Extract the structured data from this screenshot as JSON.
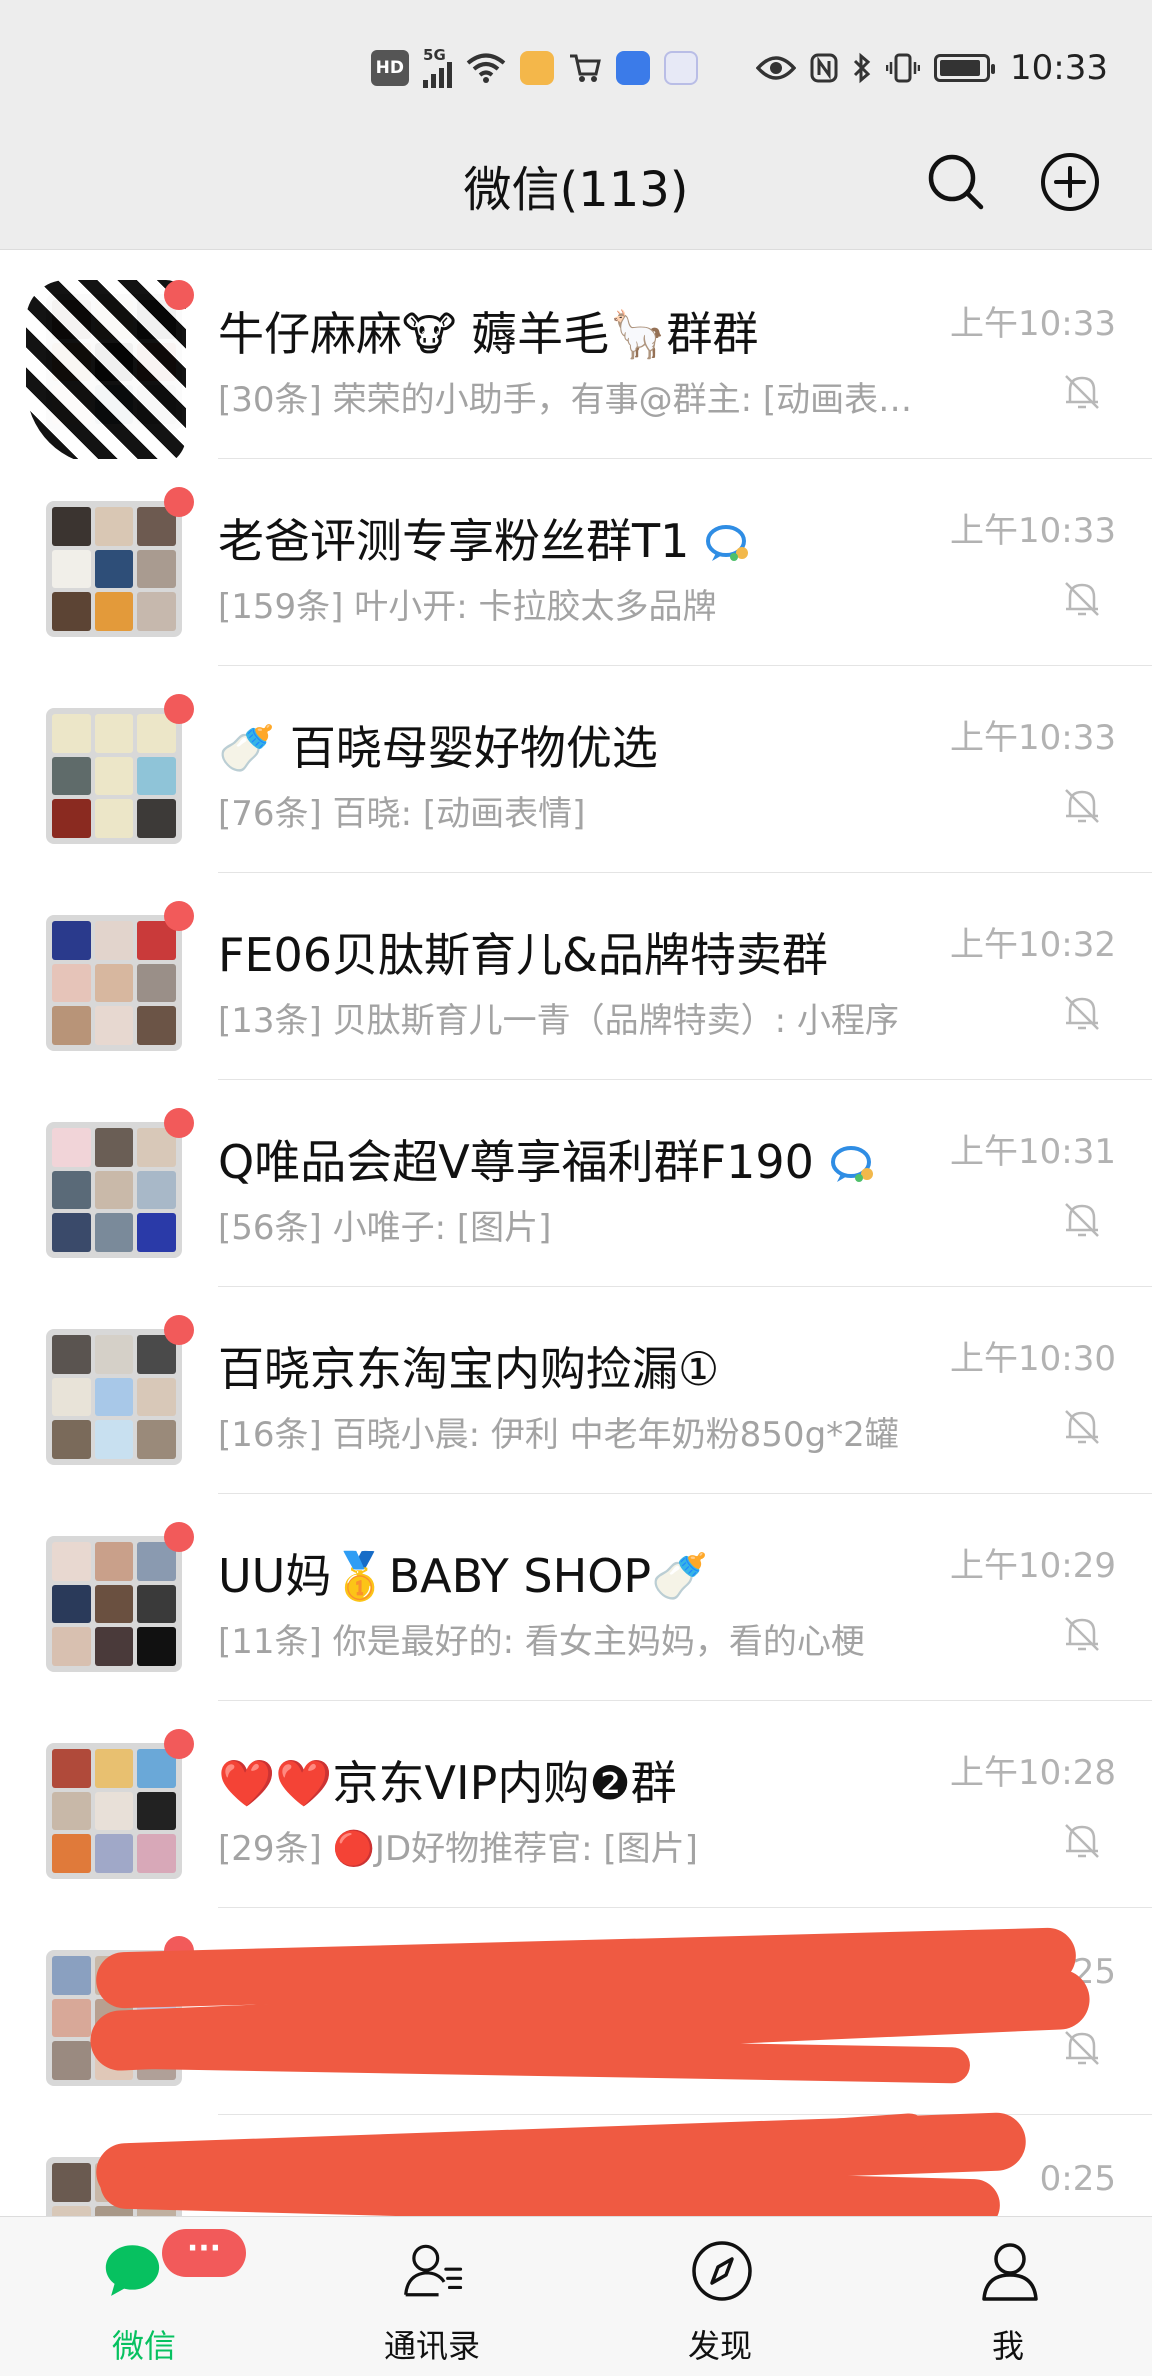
{
  "status_bar": {
    "hd": "HD",
    "network": "5G",
    "time": "10:33"
  },
  "header": {
    "title": "微信(113)",
    "icons": [
      "search-icon",
      "add-icon"
    ]
  },
  "chats": [
    {
      "name": "牛仔麻麻🐮 薅羊毛🦙群群",
      "preview": "[30条] 荣荣的小助手，有事@群主: [动画表情]",
      "time": "上午10:33",
      "muted": true
    },
    {
      "name": "老爸评测专享粉丝群T1",
      "preview": "[159条] 叶小开: 卡拉胶太多品牌",
      "time": "上午10:33",
      "muted": true
    },
    {
      "name": "🍼 百晓母婴好物优选",
      "preview": "[76条] 百晓: [动画表情]",
      "time": "上午10:33",
      "muted": true
    },
    {
      "name": "FE06贝肽斯育儿&品牌特卖群",
      "preview": "[13条] 贝肽斯育儿一青（品牌特卖）: 小程序",
      "time": "上午10:32",
      "muted": true
    },
    {
      "name": "Q唯品会超V尊享福利群F190",
      "preview": "[56条] 小唯子: [图片]",
      "time": "上午10:31",
      "muted": true
    },
    {
      "name": "百晓京东淘宝内购捡漏①",
      "preview": "[16条] 百晓小晨: 伊利 中老年奶粉850g*2罐",
      "time": "上午10:30",
      "muted": true
    },
    {
      "name": "UU妈🥇BABY SHOP🍼",
      "preview": "[11条] 你是最好的: 看女主妈妈，看的心梗",
      "time": "上午10:29",
      "muted": true
    },
    {
      "name": "❤️❤️京东VIP内购❷群",
      "preview": "[29条] 🔴JD好物推荐官: [图片]",
      "time": "上午10:28",
      "muted": true
    },
    {
      "name": "",
      "preview": "",
      "time": "25",
      "muted": true
    },
    {
      "name": "",
      "preview": "",
      "time": "0:25",
      "muted": false
    }
  ],
  "tabbar": {
    "badge": "···",
    "tabs": [
      {
        "label": "微信",
        "icon": "chat-icon",
        "active": true
      },
      {
        "label": "通讯录",
        "icon": "contacts-icon",
        "active": false
      },
      {
        "label": "发现",
        "icon": "compass-icon",
        "active": false
      },
      {
        "label": "我",
        "icon": "person-icon",
        "active": false
      }
    ]
  },
  "colors": {
    "accent": "#07c160",
    "badge": "#f25a5a",
    "header_bg": "#ededed",
    "scribble": "#ef5a42"
  }
}
